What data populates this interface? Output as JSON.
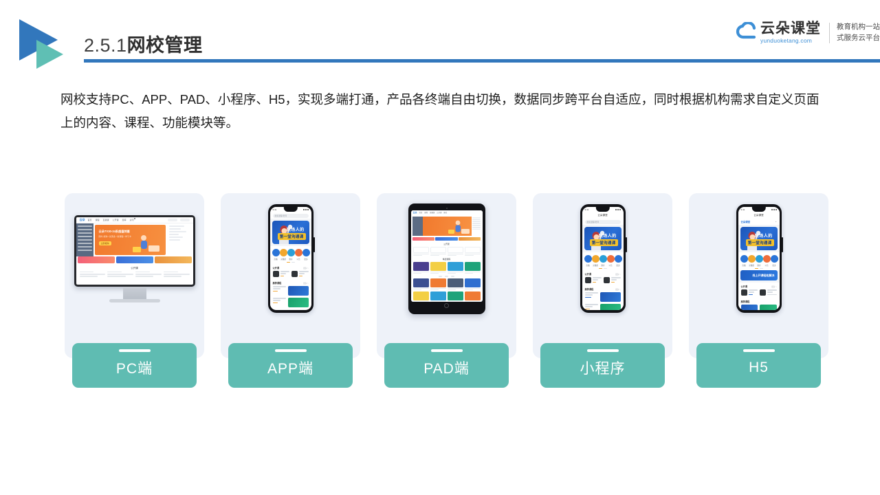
{
  "header": {
    "section_number": "2.5.1",
    "title_cn": "网校管理",
    "logo_icon": "double-triangle-logo"
  },
  "brand": {
    "name_cn": "云朵课堂",
    "domain": "yunduoketang.com",
    "tagline_line1": "教育机构一站",
    "tagline_line2": "式服务云平台",
    "cloud_icon": "cloud-icon",
    "accent_blue": "#3277bc",
    "accent_teal": "#5fbcb2"
  },
  "intro": {
    "paragraph": "网校支持PC、APP、PAD、小程序、H5，实现多端打通，产品各终端自由切换，数据同步跨平台自适应，同时根据机构需求自定义页面上的内容、课程、功能模块等。"
  },
  "cards": [
    {
      "label": "PC端",
      "device": "desktop-monitor",
      "device_icon": "monitor-icon"
    },
    {
      "label": "APP端",
      "device": "smartphone",
      "device_icon": "phone-icon"
    },
    {
      "label": "PAD端",
      "device": "tablet",
      "device_icon": "tablet-icon"
    },
    {
      "label": "小程序",
      "device": "smartphone",
      "device_icon": "phone-icon"
    },
    {
      "label": "H5",
      "device": "smartphone",
      "device_icon": "phone-icon"
    }
  ],
  "mock_ui": {
    "pc": {
      "logo": "云朵",
      "nav": [
        "首页",
        "课程",
        "直播课",
        "公开课",
        "题库",
        "资讯"
      ],
      "hero_title": "云朵TV30-34系超值特惠",
      "hero_sub": "限时 抢购 / 优惠多 / 新课程 / 学习卡",
      "hero_btn": "立即抢购",
      "section_title": "公开课"
    },
    "app": {
      "statusbar_time": "9:41",
      "navbar_title": "云朵课堂",
      "search_placeholder": "搜索课程/老师",
      "hero_line1": "职场人的",
      "hero_line2": "第一堂沟通课",
      "icons": [
        "直播",
        "录播课",
        "题库",
        "公告",
        "更多"
      ],
      "section1_title": "公开课",
      "section1_more": "更多 >",
      "section2_title": "推荐课程",
      "section2_more": "更多 >"
    },
    "pad": {
      "logo": "云朵",
      "nav": [
        "首页",
        "课程",
        "直播课",
        "公开课",
        "题库",
        "资讯"
      ],
      "section_a": "公开课",
      "section_b": "精选课程",
      "section_c": "课程"
    },
    "h5": {
      "navbar_title": "云朵课堂",
      "brand": "云朵课堂",
      "hero_line1": "职场人的",
      "hero_line2": "第一堂沟通课",
      "banner_text": "线上开课轻松解决",
      "section1_title": "公开课",
      "section2_title": "推荐课程"
    }
  },
  "colors": {
    "card_bg": "#eef2f9",
    "pill": "#5fbcb2",
    "header_rule": "#3277bc",
    "logo_blue": "#3277bc",
    "logo_teal": "#5fbfb4",
    "text_dark": "#1d1d1d"
  }
}
